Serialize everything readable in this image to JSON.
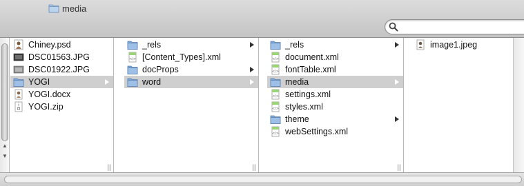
{
  "window": {
    "path_folder": "media"
  },
  "search": {
    "placeholder": ""
  },
  "columns": [
    {
      "items": [
        {
          "label": "Chiney.psd",
          "icon": "psd-file-icon",
          "type": "file"
        },
        {
          "label": "DSC01563.JPG",
          "icon": "jpg-thumb-icon",
          "type": "file"
        },
        {
          "label": "DSC01922.JPG",
          "icon": "jpg-thumb-icon",
          "type": "file"
        },
        {
          "label": "YOGI",
          "icon": "folder-icon",
          "type": "folder",
          "selected": true
        },
        {
          "label": "YOGI.docx",
          "icon": "docx-file-icon",
          "type": "file"
        },
        {
          "label": "YOGI.zip",
          "icon": "zip-file-icon",
          "type": "file"
        }
      ]
    },
    {
      "items": [
        {
          "label": "_rels",
          "icon": "folder-icon",
          "type": "folder"
        },
        {
          "label": "[Content_Types].xml",
          "icon": "xml-file-icon",
          "type": "file"
        },
        {
          "label": "docProps",
          "icon": "folder-icon",
          "type": "folder"
        },
        {
          "label": "word",
          "icon": "folder-icon",
          "type": "folder",
          "selected": true
        }
      ]
    },
    {
      "items": [
        {
          "label": "_rels",
          "icon": "folder-icon",
          "type": "folder"
        },
        {
          "label": "document.xml",
          "icon": "xml-file-icon",
          "type": "file"
        },
        {
          "label": "fontTable.xml",
          "icon": "xml-file-icon",
          "type": "file"
        },
        {
          "label": "media",
          "icon": "folder-icon",
          "type": "folder",
          "selected": true
        },
        {
          "label": "settings.xml",
          "icon": "xml-file-icon",
          "type": "file"
        },
        {
          "label": "styles.xml",
          "icon": "xml-file-icon",
          "type": "file"
        },
        {
          "label": "theme",
          "icon": "folder-icon",
          "type": "folder"
        },
        {
          "label": "webSettings.xml",
          "icon": "xml-file-icon",
          "type": "file"
        }
      ]
    },
    {
      "items": [
        {
          "label": "image1.jpeg",
          "icon": "jpeg-file-icon",
          "type": "file"
        }
      ]
    }
  ],
  "colors": {
    "selection": "#cfcfcf",
    "folder": "#8fb4df"
  }
}
